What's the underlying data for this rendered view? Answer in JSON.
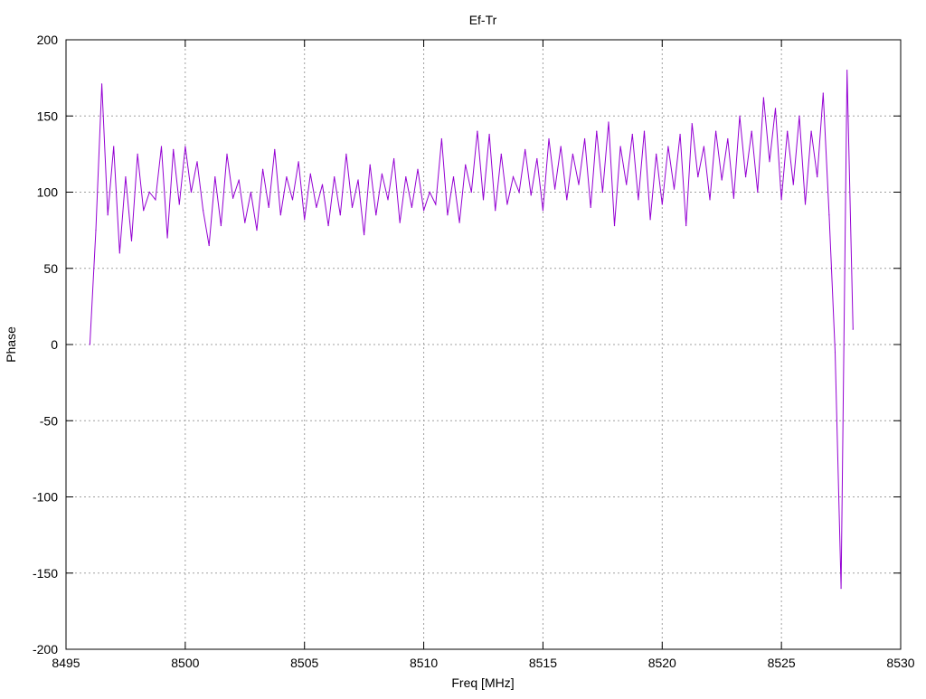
{
  "chart_data": {
    "type": "line",
    "title": "Ef-Tr",
    "xlabel": "Freq [MHz]",
    "ylabel": "Phase",
    "xlim": [
      8495,
      8530
    ],
    "ylim": [
      -200,
      200
    ],
    "xticks": [
      8495,
      8500,
      8505,
      8510,
      8515,
      8520,
      8525,
      8530
    ],
    "yticks": [
      -200,
      -150,
      -100,
      -50,
      0,
      50,
      100,
      150,
      200
    ],
    "grid": true,
    "legend": "none",
    "series": [
      {
        "name": "Ef-Tr",
        "color": "#9400d3",
        "x_start": 8496,
        "x_step": 0.25,
        "values": [
          0,
          75,
          171,
          85,
          130,
          60,
          110,
          68,
          125,
          88,
          100,
          95,
          130,
          70,
          128,
          92,
          130,
          100,
          120,
          88,
          65,
          110,
          78,
          125,
          96,
          108,
          80,
          100,
          75,
          115,
          90,
          128,
          85,
          110,
          95,
          120,
          82,
          112,
          90,
          105,
          78,
          110,
          85,
          125,
          90,
          108,
          72,
          118,
          85,
          112,
          95,
          122,
          80,
          110,
          90,
          115,
          88,
          100,
          92,
          135,
          85,
          110,
          80,
          118,
          100,
          140,
          95,
          138,
          88,
          125,
          92,
          110,
          100,
          128,
          98,
          122,
          88,
          135,
          102,
          130,
          95,
          125,
          105,
          135,
          90,
          140,
          100,
          146,
          78,
          130,
          105,
          138,
          95,
          140,
          82,
          125,
          92,
          130,
          102,
          138,
          78,
          145,
          110,
          130,
          95,
          140,
          108,
          135,
          96,
          150,
          110,
          140,
          100,
          162,
          120,
          155,
          95,
          140,
          105,
          150,
          92,
          140,
          110,
          165,
          85,
          -5,
          -160,
          180,
          10
        ]
      }
    ]
  }
}
